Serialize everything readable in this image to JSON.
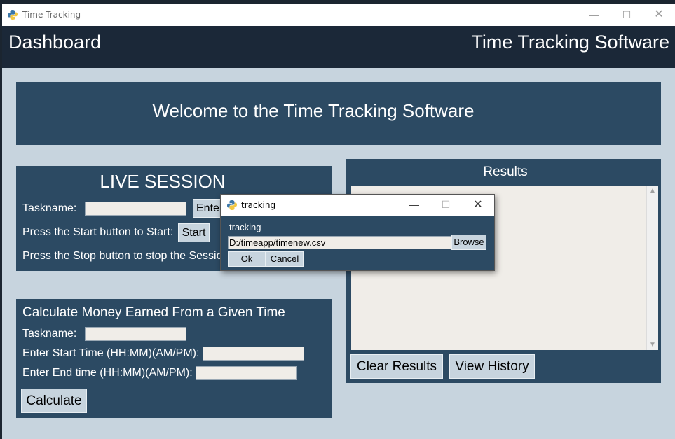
{
  "window": {
    "title": "Time Tracking"
  },
  "header": {
    "left": "Dashboard",
    "right": "Time Tracking Software"
  },
  "welcome": {
    "text": "Welcome to the Time Tracking Software"
  },
  "live_session": {
    "title": "LIVE SESSION",
    "taskname_label": "Taskname:",
    "taskname_value": "",
    "enter_button": "Enter",
    "start_prompt": "Press the Start button to Start:",
    "start_button": "Start",
    "stop_prompt": "Press the Stop button to stop the Session:"
  },
  "calculate": {
    "title": "Calculate Money Earned From a Given Time",
    "taskname_label": "Taskname:",
    "start_label": "Enter Start Time (HH:MM)(AM/PM):",
    "end_label": "Enter End time (HH:MM)(AM/PM):",
    "button": "Calculate"
  },
  "results": {
    "title": "Results",
    "content": "",
    "clear_button": "Clear Results",
    "history_button": "View History"
  },
  "dialog": {
    "title": "tracking",
    "label": "tracking",
    "path_value": "D:/timeapp/timenew.csv",
    "browse_button": "Browse",
    "ok_button": "Ok",
    "cancel_button": "Cancel"
  },
  "colors": {
    "header_bg": "#1b2838",
    "panel_bg": "#2c4a63",
    "window_bg": "#c7d4de",
    "entry_bg": "#f0ede8"
  }
}
